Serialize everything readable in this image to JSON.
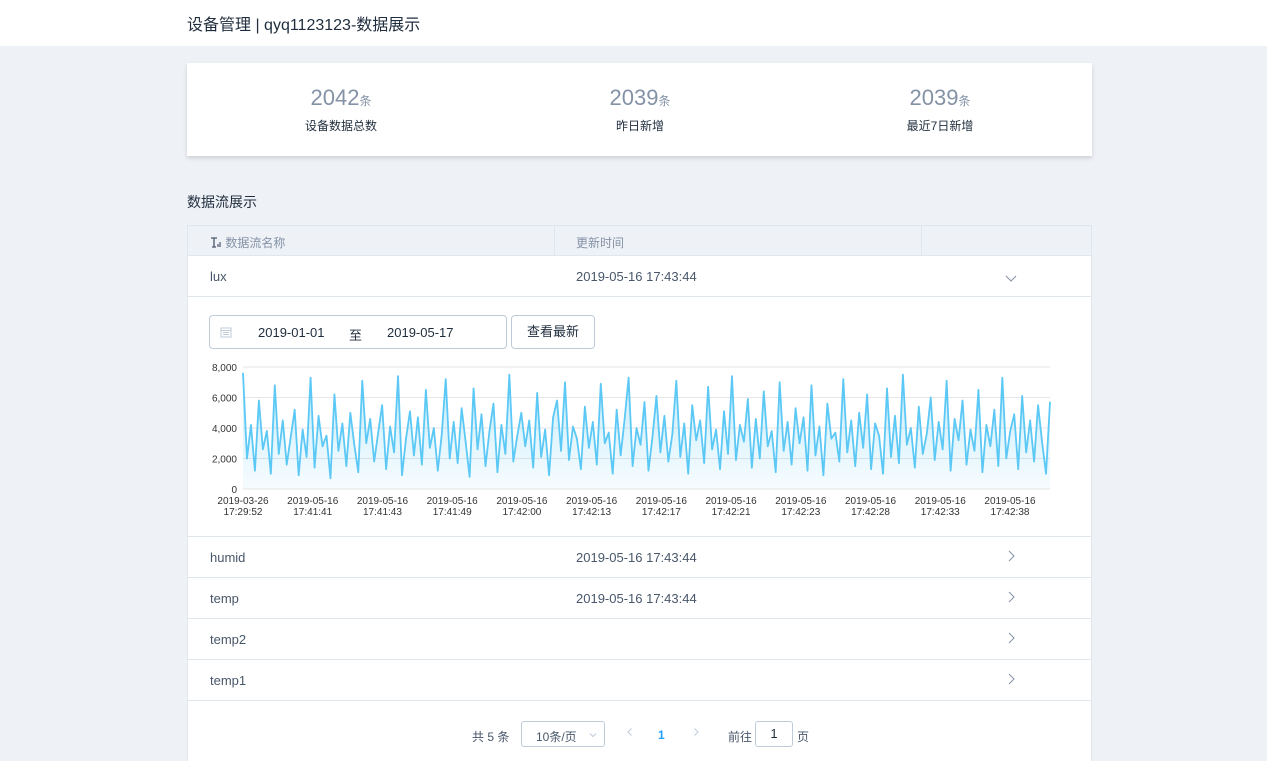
{
  "header": {
    "title": "设备管理 | qyq1123123-数据展示"
  },
  "stats": [
    {
      "value": "2042",
      "unit": "条",
      "label": "设备数据总数"
    },
    {
      "value": "2039",
      "unit": "条",
      "label": "昨日新增"
    },
    {
      "value": "2039",
      "unit": "条",
      "label": "最近7日新增"
    }
  ],
  "section": {
    "title": "数据流展示"
  },
  "table": {
    "headers": [
      "数据流名称",
      "更新时间"
    ],
    "rows": [
      {
        "name": "lux",
        "time": "2019-05-16 17:43:44",
        "expanded": true
      },
      {
        "name": "humid",
        "time": "2019-05-16 17:43:44"
      },
      {
        "name": "temp",
        "time": "2019-05-16 17:43:44"
      },
      {
        "name": "temp2",
        "time": ""
      },
      {
        "name": "temp1",
        "time": ""
      }
    ]
  },
  "datepicker": {
    "start": "2019-01-01",
    "separator": "至",
    "end": "2019-05-17",
    "button_label": "查看最新"
  },
  "chart_data": {
    "type": "area",
    "color": "#5bc8f5",
    "ylim": [
      0,
      8000
    ],
    "yticks": [
      "0",
      "2,000",
      "4,000",
      "6,000",
      "8,000"
    ],
    "xticks": [
      [
        "2019-03-26",
        "17:29:52"
      ],
      [
        "2019-05-16",
        "17:41:41"
      ],
      [
        "2019-05-16",
        "17:41:43"
      ],
      [
        "2019-05-16",
        "17:41:49"
      ],
      [
        "2019-05-16",
        "17:42:00"
      ],
      [
        "2019-05-16",
        "17:42:13"
      ],
      [
        "2019-05-16",
        "17:42:17"
      ],
      [
        "2019-05-16",
        "17:42:21"
      ],
      [
        "2019-05-16",
        "17:42:23"
      ],
      [
        "2019-05-16",
        "17:42:28"
      ],
      [
        "2019-05-16",
        "17:42:33"
      ],
      [
        "2019-05-16",
        "17:42:38"
      ]
    ],
    "values": [
      7600,
      2000,
      4200,
      1200,
      5800,
      2600,
      3800,
      1000,
      6800,
      2300,
      4500,
      1600,
      3400,
      5200,
      900,
      3900,
      2100,
      7300,
      1400,
      4800,
      2800,
      3500,
      700,
      6200,
      2500,
      4300,
      1500,
      5000,
      2900,
      1100,
      7100,
      3000,
      4600,
      1800,
      3700,
      5500,
      1300,
      4100,
      2400,
      7400,
      900,
      3300,
      5100,
      2200,
      4700,
      1600,
      6500,
      2700,
      4000,
      1200,
      3600,
      7200,
      2000,
      4400,
      1700,
      5300,
      3100,
      800,
      6600,
      2600,
      4900,
      1500,
      3800,
      5600,
      1100,
      4200,
      2300,
      7500,
      1800,
      3500,
      5000,
      2800,
      4500,
      1400,
      6300,
      2100,
      3900,
      900,
      4700,
      5800,
      2500,
      7000,
      1900,
      4100,
      3300,
      1300,
      5400,
      2700,
      4400,
      1600,
      6900,
      3000,
      3700,
      1000,
      5200,
      2200,
      4600,
      7300,
      1500,
      4000,
      2900,
      5700,
      1200,
      3400,
      6100,
      2400,
      4800,
      1800,
      3600,
      7100,
      2100,
      4300,
      1000,
      5500,
      3200,
      4500,
      1700,
      6700,
      2600,
      3900,
      1300,
      5100,
      2300,
      7400,
      1900,
      4200,
      3100,
      5900,
      1400,
      4600,
      2000,
      6400,
      2800,
      3800,
      1100,
      7000,
      2500,
      4400,
      1600,
      5300,
      3000,
      4700,
      1200,
      6800,
      2200,
      4100,
      900,
      5600,
      3300,
      3700,
      1800,
      7200,
      2400,
      4500,
      1500,
      5000,
      2700,
      6200,
      1300,
      4300,
      3500,
      1000,
      6600,
      2100,
      4800,
      1700,
      7500,
      2900,
      4000,
      1400,
      5400,
      2300,
      3600,
      6000,
      1900,
      4400,
      2600,
      7100,
      1200,
      4600,
      3200,
      5800,
      1600,
      3900,
      2500,
      6500,
      1100,
      4200,
      2800,
      5200,
      1500,
      7300,
      2000,
      3800,
      4900,
      1300,
      6100,
      2400,
      4500,
      1800,
      5500,
      3100,
      1000,
      5700
    ]
  },
  "pagination": {
    "total": "共 5 条",
    "page_size": "10条/页",
    "current_page": "1",
    "goto_label": "前往",
    "goto_value": "1",
    "page_suffix": "页"
  }
}
